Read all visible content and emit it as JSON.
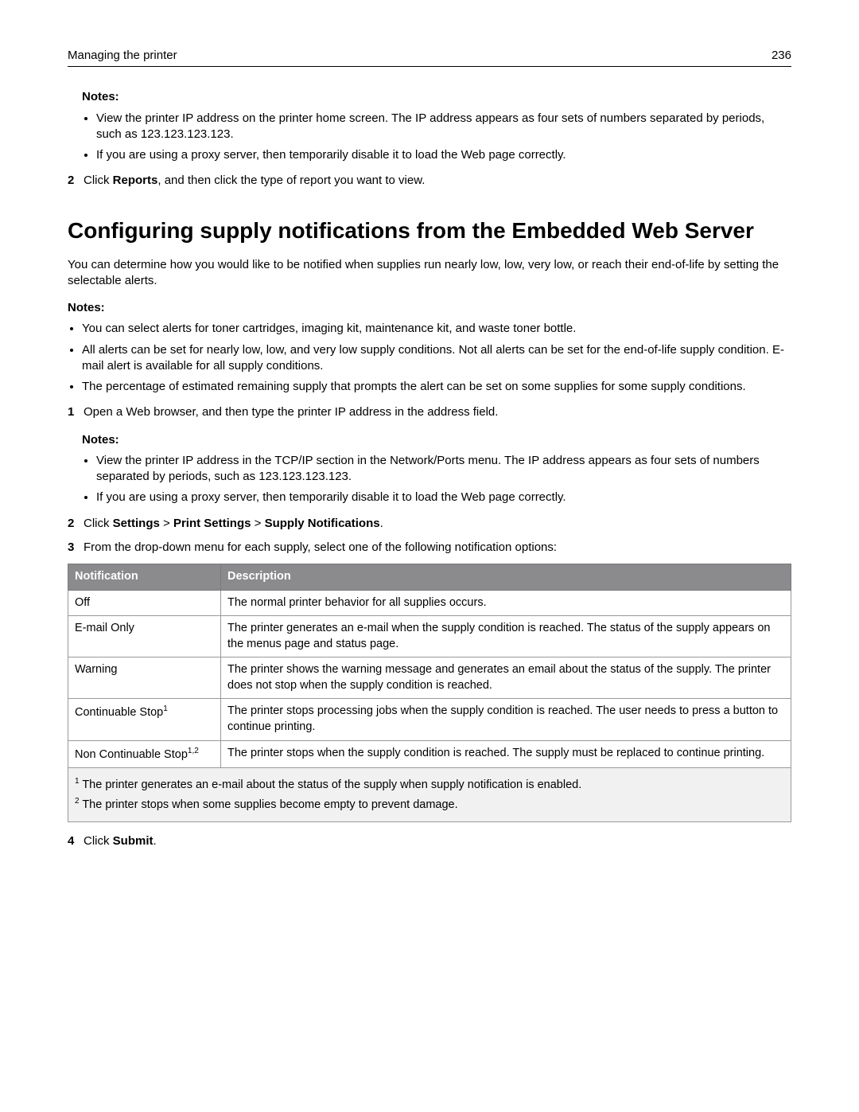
{
  "header": {
    "title": "Managing the printer",
    "page": "236"
  },
  "topNotes": {
    "label": "Notes:",
    "items": [
      "View the printer IP address on the printer home screen. The IP address appears as four sets of numbers separated by periods, such as 123.123.123.123.",
      "If you are using a proxy server, then temporarily disable it to load the Web page correctly."
    ]
  },
  "step2Top": {
    "num": "2",
    "prefix": "Click ",
    "bold": "Reports",
    "suffix": ", and then click the type of report you want to view."
  },
  "sectionHeading": "Configuring supply notifications from the Embedded Web Server",
  "introPara": "You can determine how you would like to be notified when supplies run nearly low, low, very low, or reach their end-of-life by setting the selectable alerts.",
  "midNotes": {
    "label": "Notes:",
    "items": [
      "You can select alerts for toner cartridges, imaging kit, maintenance kit, and waste toner bottle.",
      "All alerts can be set for nearly low, low, and very low supply conditions. Not all alerts can be set for the end-of-life supply condition. E-mail alert is available for all supply conditions.",
      "The percentage of estimated remaining supply that prompts the alert can be set on some supplies for some supply conditions."
    ]
  },
  "step1": {
    "num": "1",
    "text": "Open a Web browser, and then type the printer IP address in the address field."
  },
  "step1Notes": {
    "label": "Notes:",
    "items": [
      "View the printer IP address in the TCP/IP section in the Network/Ports menu. The IP address appears as four sets of numbers separated by periods, such as 123.123.123.123.",
      "If you are using a proxy server, then temporarily disable it to load the Web page correctly."
    ]
  },
  "step2": {
    "num": "2",
    "prefix": "Click ",
    "b1": "Settings",
    "sep1": " > ",
    "b2": "Print Settings",
    "sep2": " > ",
    "b3": "Supply Notifications",
    "suffix": "."
  },
  "step3": {
    "num": "3",
    "text": "From the drop-down menu for each supply, select one of the following notification options:"
  },
  "table": {
    "headers": {
      "col1": "Notification",
      "col2": "Description"
    },
    "rows": [
      {
        "name": "Off",
        "sup": "",
        "desc": "The normal printer behavior for all supplies occurs."
      },
      {
        "name": "E-mail Only",
        "sup": "",
        "desc": "The printer generates an e-mail when the supply condition is reached. The status of the supply appears on the menus page and status page."
      },
      {
        "name": "Warning",
        "sup": "",
        "desc": "The printer shows the warning message and generates an email about the status of the supply. The printer does not stop when the supply condition is reached."
      },
      {
        "name": "Continuable Stop",
        "sup": "1",
        "desc": "The printer stops processing jobs when the supply condition is reached. The user needs to press a button to continue printing."
      },
      {
        "name": "Non Continuable Stop",
        "sup": "1,2",
        "desc": "The printer stops when the supply condition is reached. The supply must be replaced to continue printing."
      }
    ],
    "footnotes": [
      {
        "sup": "1",
        "text": " The printer generates an e-mail about the status of the supply when supply notification is enabled."
      },
      {
        "sup": "2",
        "text": " The printer stops when some supplies become empty to prevent damage."
      }
    ]
  },
  "step4": {
    "num": "4",
    "prefix": "Click ",
    "bold": "Submit",
    "suffix": "."
  }
}
